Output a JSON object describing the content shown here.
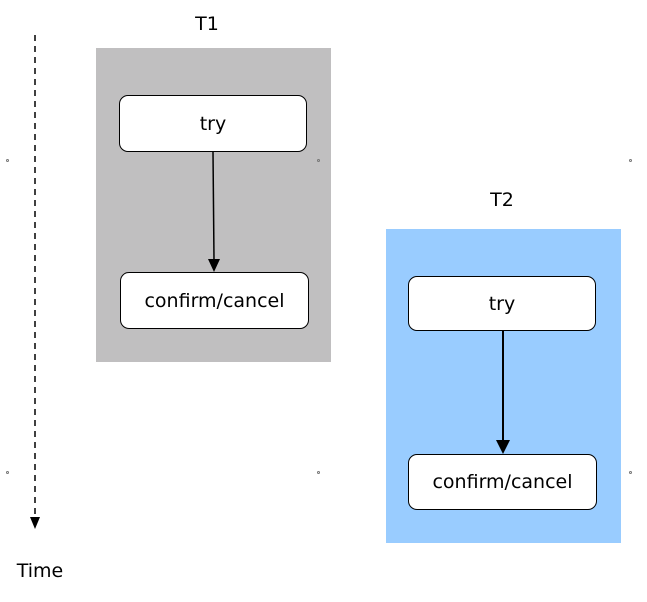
{
  "time_axis": {
    "label": "Time"
  },
  "lanes": [
    {
      "title": "T1",
      "color": "#c0bfc0",
      "steps": [
        "try",
        "confirm/cancel"
      ]
    },
    {
      "title": "T2",
      "color": "#99ccff",
      "steps": [
        "try",
        "confirm/cancel"
      ]
    }
  ]
}
